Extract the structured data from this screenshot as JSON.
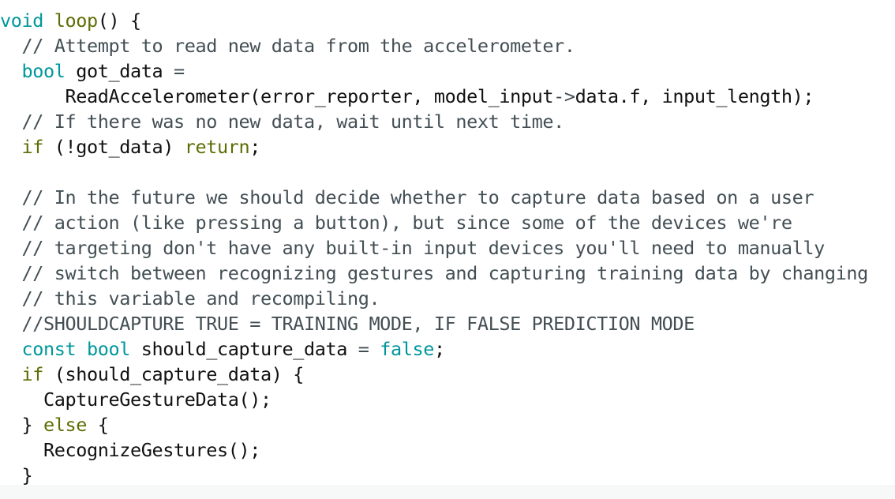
{
  "editor": {
    "lines": [
      [
        {
          "t": "void",
          "c": "kw-type"
        },
        {
          "t": " ",
          "c": "plain"
        },
        {
          "t": "loop",
          "c": "kw-ctrl"
        },
        {
          "t": "() {",
          "c": "plain"
        }
      ],
      [
        {
          "t": "  // Attempt to read new data from the accelerometer.",
          "c": "comment"
        }
      ],
      [
        {
          "t": "  ",
          "c": "plain"
        },
        {
          "t": "bool",
          "c": "kw-type"
        },
        {
          "t": " got_data ",
          "c": "plain"
        },
        {
          "t": "=",
          "c": "op"
        }
      ],
      [
        {
          "t": "      ReadAccelerometer(error_reporter, model_input",
          "c": "plain"
        },
        {
          "t": "->",
          "c": "op"
        },
        {
          "t": "data.f, input_length);",
          "c": "plain"
        }
      ],
      [
        {
          "t": "  // If there was no new data, wait until next time.",
          "c": "comment"
        }
      ],
      [
        {
          "t": "  ",
          "c": "plain"
        },
        {
          "t": "if",
          "c": "kw-ctrl"
        },
        {
          "t": " (!got_data) ",
          "c": "plain"
        },
        {
          "t": "return",
          "c": "kw-ctrl"
        },
        {
          "t": ";",
          "c": "plain"
        }
      ],
      [
        {
          "t": "",
          "c": "plain"
        }
      ],
      [
        {
          "t": "  // In the future we should decide whether to capture data based on a user",
          "c": "comment"
        }
      ],
      [
        {
          "t": "  // action (like pressing a button), but since some of the devices we're",
          "c": "comment"
        }
      ],
      [
        {
          "t": "  // targeting don't have any built-in input devices you'll need to manually",
          "c": "comment"
        }
      ],
      [
        {
          "t": "  // switch between recognizing gestures and capturing training data by changing",
          "c": "comment"
        }
      ],
      [
        {
          "t": "  // this variable and recompiling.",
          "c": "comment"
        }
      ],
      [
        {
          "t": "  //SHOULDCAPTURE TRUE = TRAINING MODE, IF FALSE PREDICTION MODE",
          "c": "comment"
        }
      ],
      [
        {
          "t": "  ",
          "c": "plain"
        },
        {
          "t": "const",
          "c": "kw-type"
        },
        {
          "t": " ",
          "c": "plain"
        },
        {
          "t": "bool",
          "c": "kw-type"
        },
        {
          "t": " should_capture_data ",
          "c": "plain"
        },
        {
          "t": "=",
          "c": "op"
        },
        {
          "t": " ",
          "c": "plain"
        },
        {
          "t": "false",
          "c": "kw-type"
        },
        {
          "t": ";",
          "c": "plain"
        }
      ],
      [
        {
          "t": "  ",
          "c": "plain"
        },
        {
          "t": "if",
          "c": "kw-ctrl"
        },
        {
          "t": " (should_capture_data) {",
          "c": "plain"
        }
      ],
      [
        {
          "t": "    CaptureGestureData();",
          "c": "plain"
        }
      ],
      [
        {
          "t": "  } ",
          "c": "plain"
        },
        {
          "t": "else",
          "c": "kw-ctrl"
        },
        {
          "t": " {",
          "c": "plain"
        }
      ],
      [
        {
          "t": "    RecognizeGestures();",
          "c": "plain"
        }
      ],
      [
        {
          "t": "  }",
          "c": "plain"
        }
      ]
    ]
  }
}
